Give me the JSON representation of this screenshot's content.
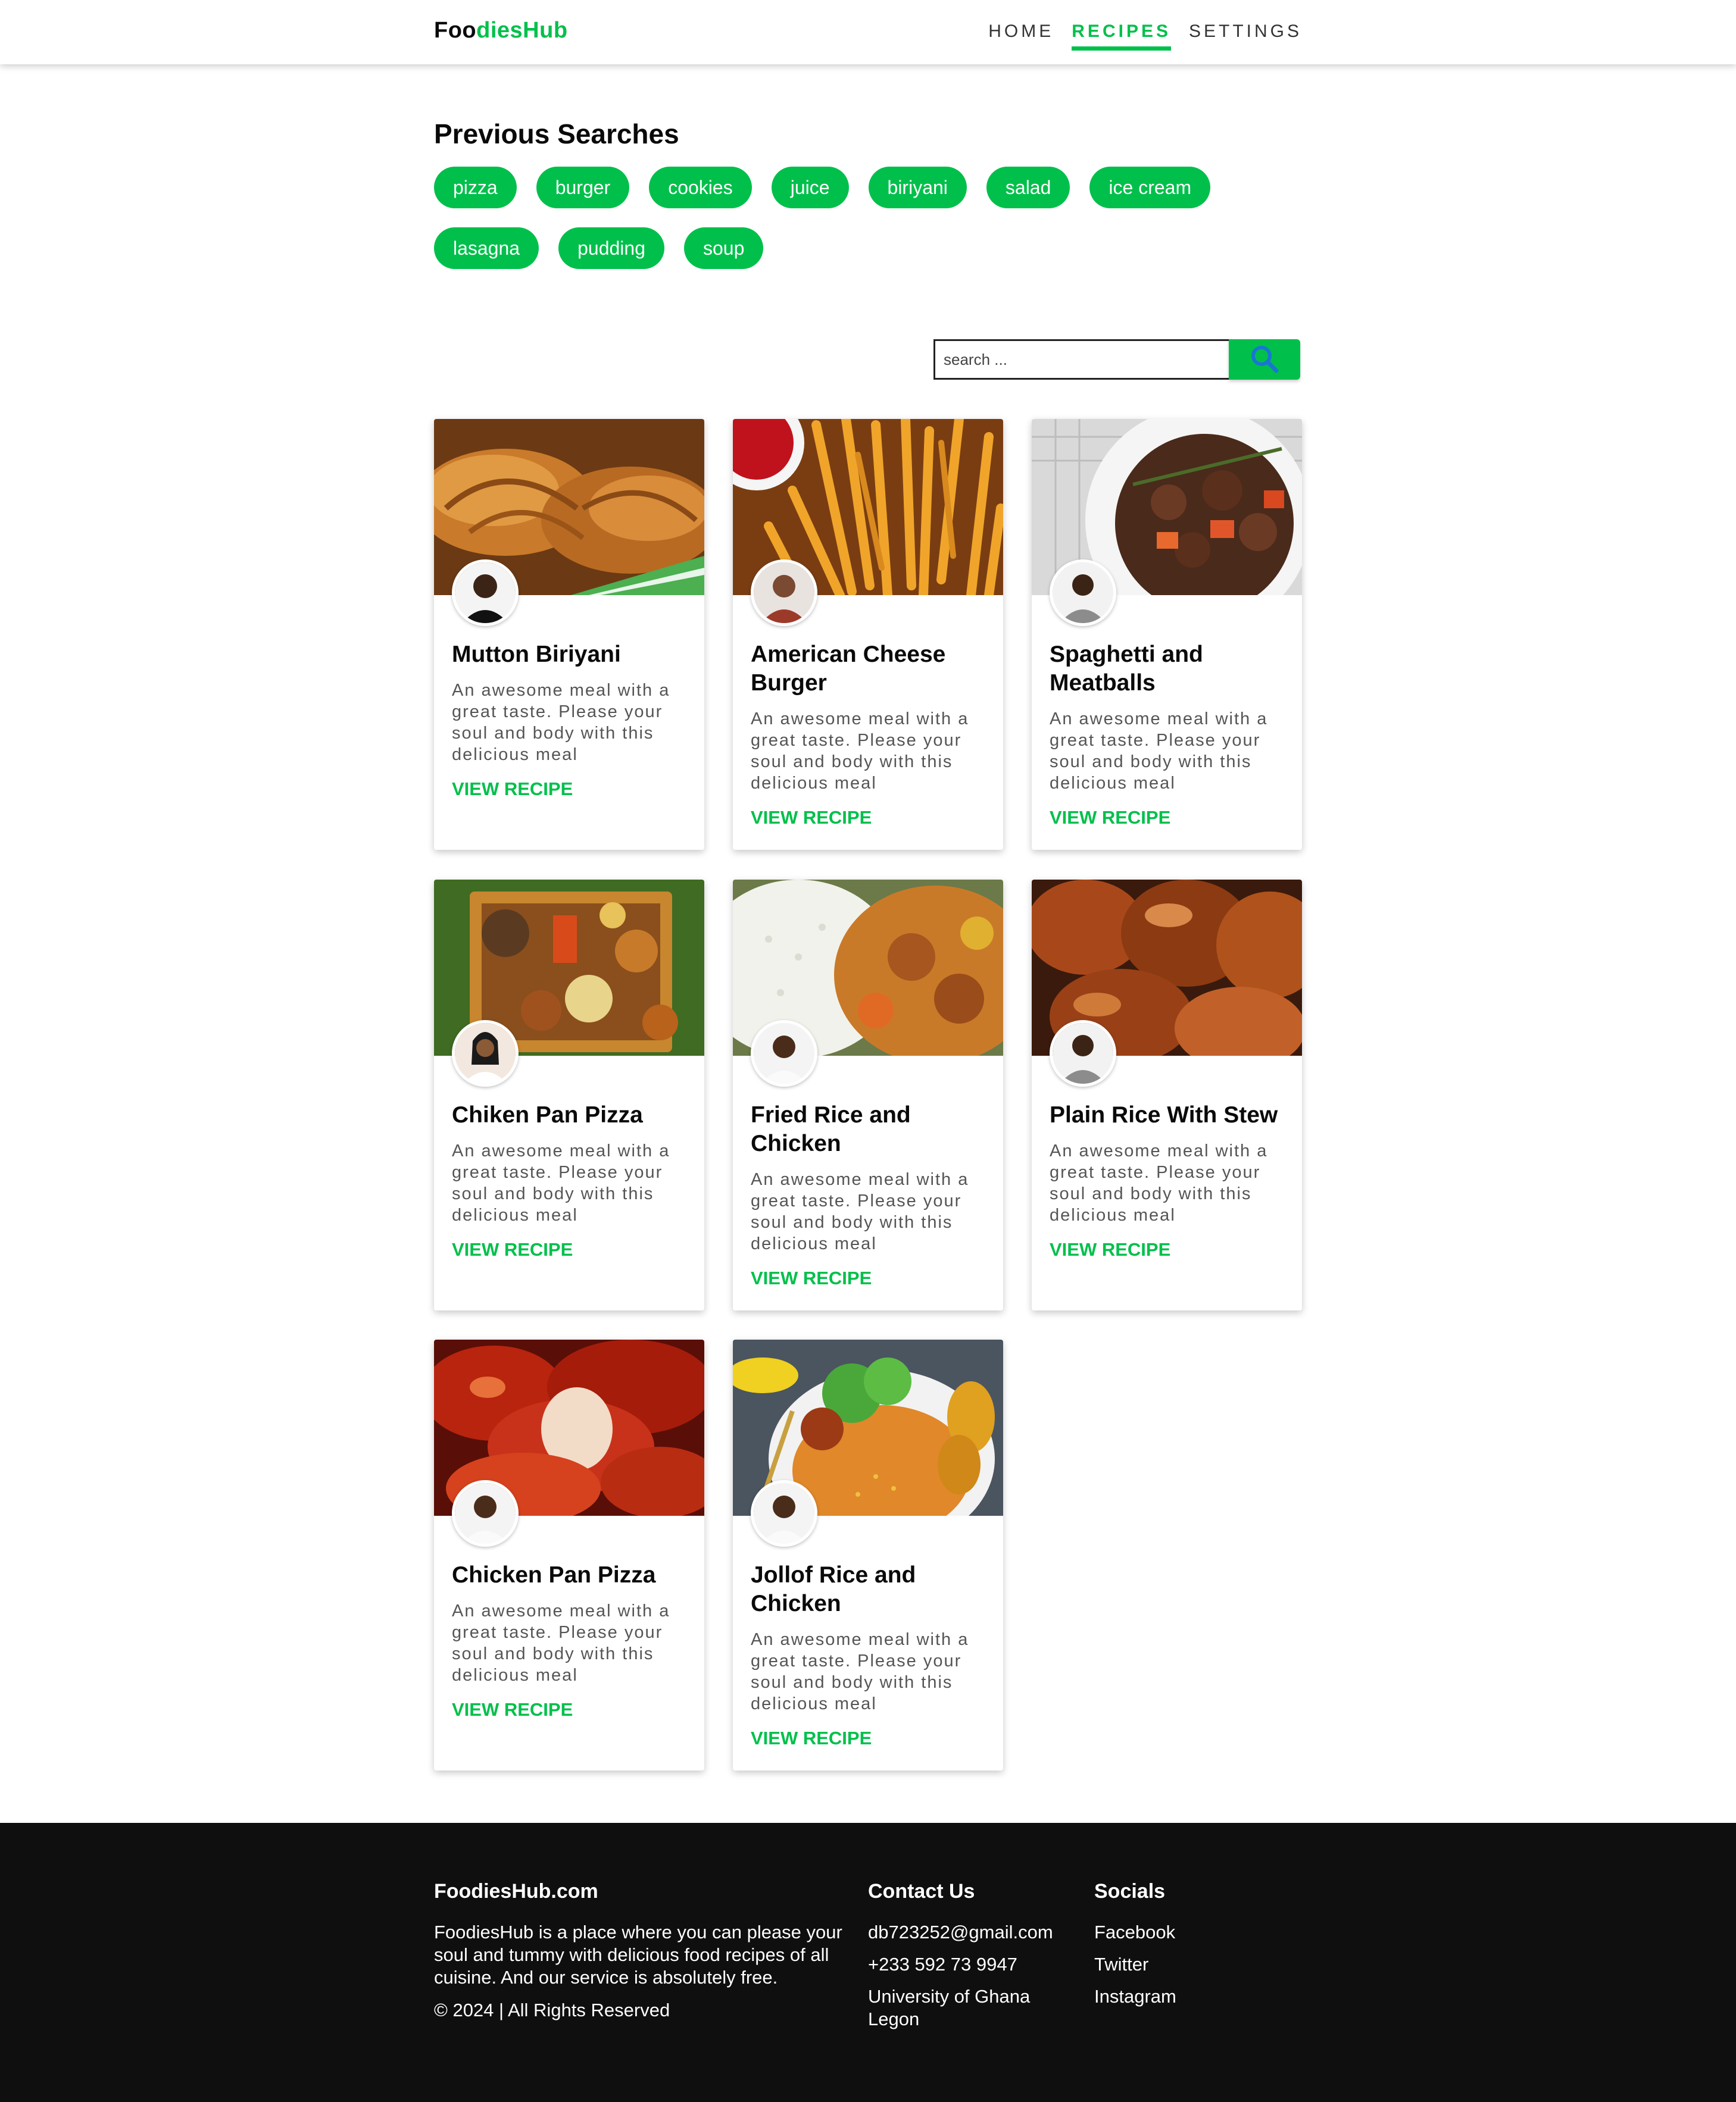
{
  "nav": {
    "brand_part1": "Foo",
    "brand_part2": "diesHub",
    "links": [
      "HOME",
      "RECIPES",
      "SETTINGS"
    ],
    "active": "RECIPES"
  },
  "previous_searches": {
    "title": "Previous Searches",
    "chips": [
      "pizza",
      "burger",
      "cookies",
      "juice",
      "biriyani",
      "salad",
      "ice cream",
      "lasagna",
      "pudding",
      "soup"
    ]
  },
  "search": {
    "placeholder": "search ...",
    "icon": "search-icon"
  },
  "recipes": [
    {
      "title": "Mutton Biriyani",
      "description": "An awesome meal with a great taste. Please your soul and body with this delicious meal",
      "link": "VIEW RECIPE",
      "image": "croissants-image",
      "avatar": "chef-avatar"
    },
    {
      "title": "American Cheese Burger",
      "description": "An awesome meal with a great taste. Please your soul and body with this delicious meal",
      "link": "VIEW RECIPE",
      "image": "fries-image",
      "avatar": "chef-avatar"
    },
    {
      "title": "Spaghetti and Meatballs",
      "description": "An awesome meal with a great taste. Please your soul and body with this delicious meal",
      "link": "VIEW RECIPE",
      "image": "stew-image",
      "avatar": "chef-avatar"
    },
    {
      "title": "Chiken Pan Pizza",
      "description": "An awesome meal with a great taste. Please your soul and body with this delicious meal",
      "link": "VIEW RECIPE",
      "image": "platter-image",
      "avatar": "chef-avatar"
    },
    {
      "title": "Fried Rice and Chicken",
      "description": "An awesome meal with a great taste. Please your soul and body with this delicious meal",
      "link": "VIEW RECIPE",
      "image": "rice-curry-image",
      "avatar": "chef-avatar"
    },
    {
      "title": "Plain Rice With Stew",
      "description": "An awesome meal with a great taste. Please your soul and body with this delicious meal",
      "link": "VIEW RECIPE",
      "image": "fried-chicken-image",
      "avatar": "chef-avatar"
    },
    {
      "title": "Chicken Pan Pizza",
      "description": "An awesome meal with a great taste. Please your soul and body with this delicious meal",
      "link": "VIEW RECIPE",
      "image": "roast-chicken-image",
      "avatar": "chef-avatar"
    },
    {
      "title": "Jollof Rice and Chicken",
      "description": "An awesome meal with a great taste. Please your soul and body with this delicious meal",
      "link": "VIEW RECIPE",
      "image": "jollof-image",
      "avatar": "chef-avatar"
    }
  ],
  "footer": {
    "about": {
      "title": "FoodiesHub.com",
      "text": "FoodiesHub is a place where you can please your soul and tummy with delicious food recipes of all cuisine. And our service is absolutely free.",
      "copyright": "© 2024 | All Rights Reserved"
    },
    "contact": {
      "title": "Contact Us",
      "items": [
        "db723252@gmail.com",
        "+233 592 73 9947",
        "University of Ghana Legon"
      ]
    },
    "socials": {
      "title": "Socials",
      "items": [
        "Facebook",
        "Twitter",
        "Instagram"
      ]
    }
  },
  "colors": {
    "accent": "#00c04b",
    "footer_bg": "#0f0f0f",
    "text_dark": "#0a0a0a"
  }
}
